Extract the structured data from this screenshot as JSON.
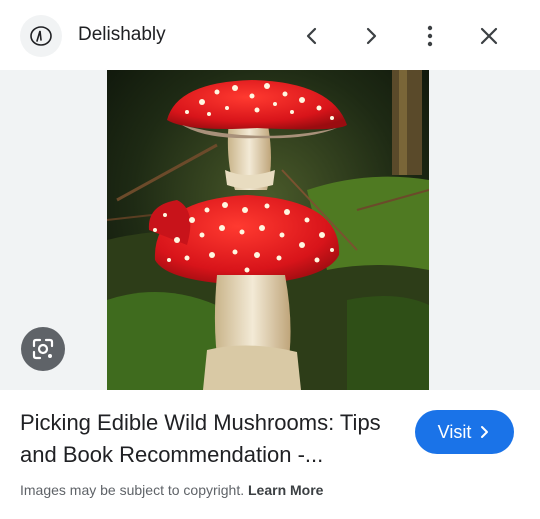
{
  "header": {
    "site_name": "Delishably"
  },
  "result": {
    "title_line1": "Picking Edible Wild Mushrooms: Tips",
    "title_line2": "and Book Recommendation -...",
    "visit_label": "Visit",
    "copyright_text": "Images may be subject to copyright.",
    "learn_more_label": "Learn More"
  },
  "icons": {
    "favicon": "site-logo-icon",
    "prev": "chevron-left-icon",
    "next": "chevron-right-icon",
    "more": "more-vertical-icon",
    "close": "close-icon",
    "lens": "lens-search-icon",
    "visit_chevron": "chevron-right-icon"
  },
  "colors": {
    "accent": "#1a73e8",
    "image_bg": "#f1f3f4",
    "mushroom_cap": "#e0191e"
  }
}
